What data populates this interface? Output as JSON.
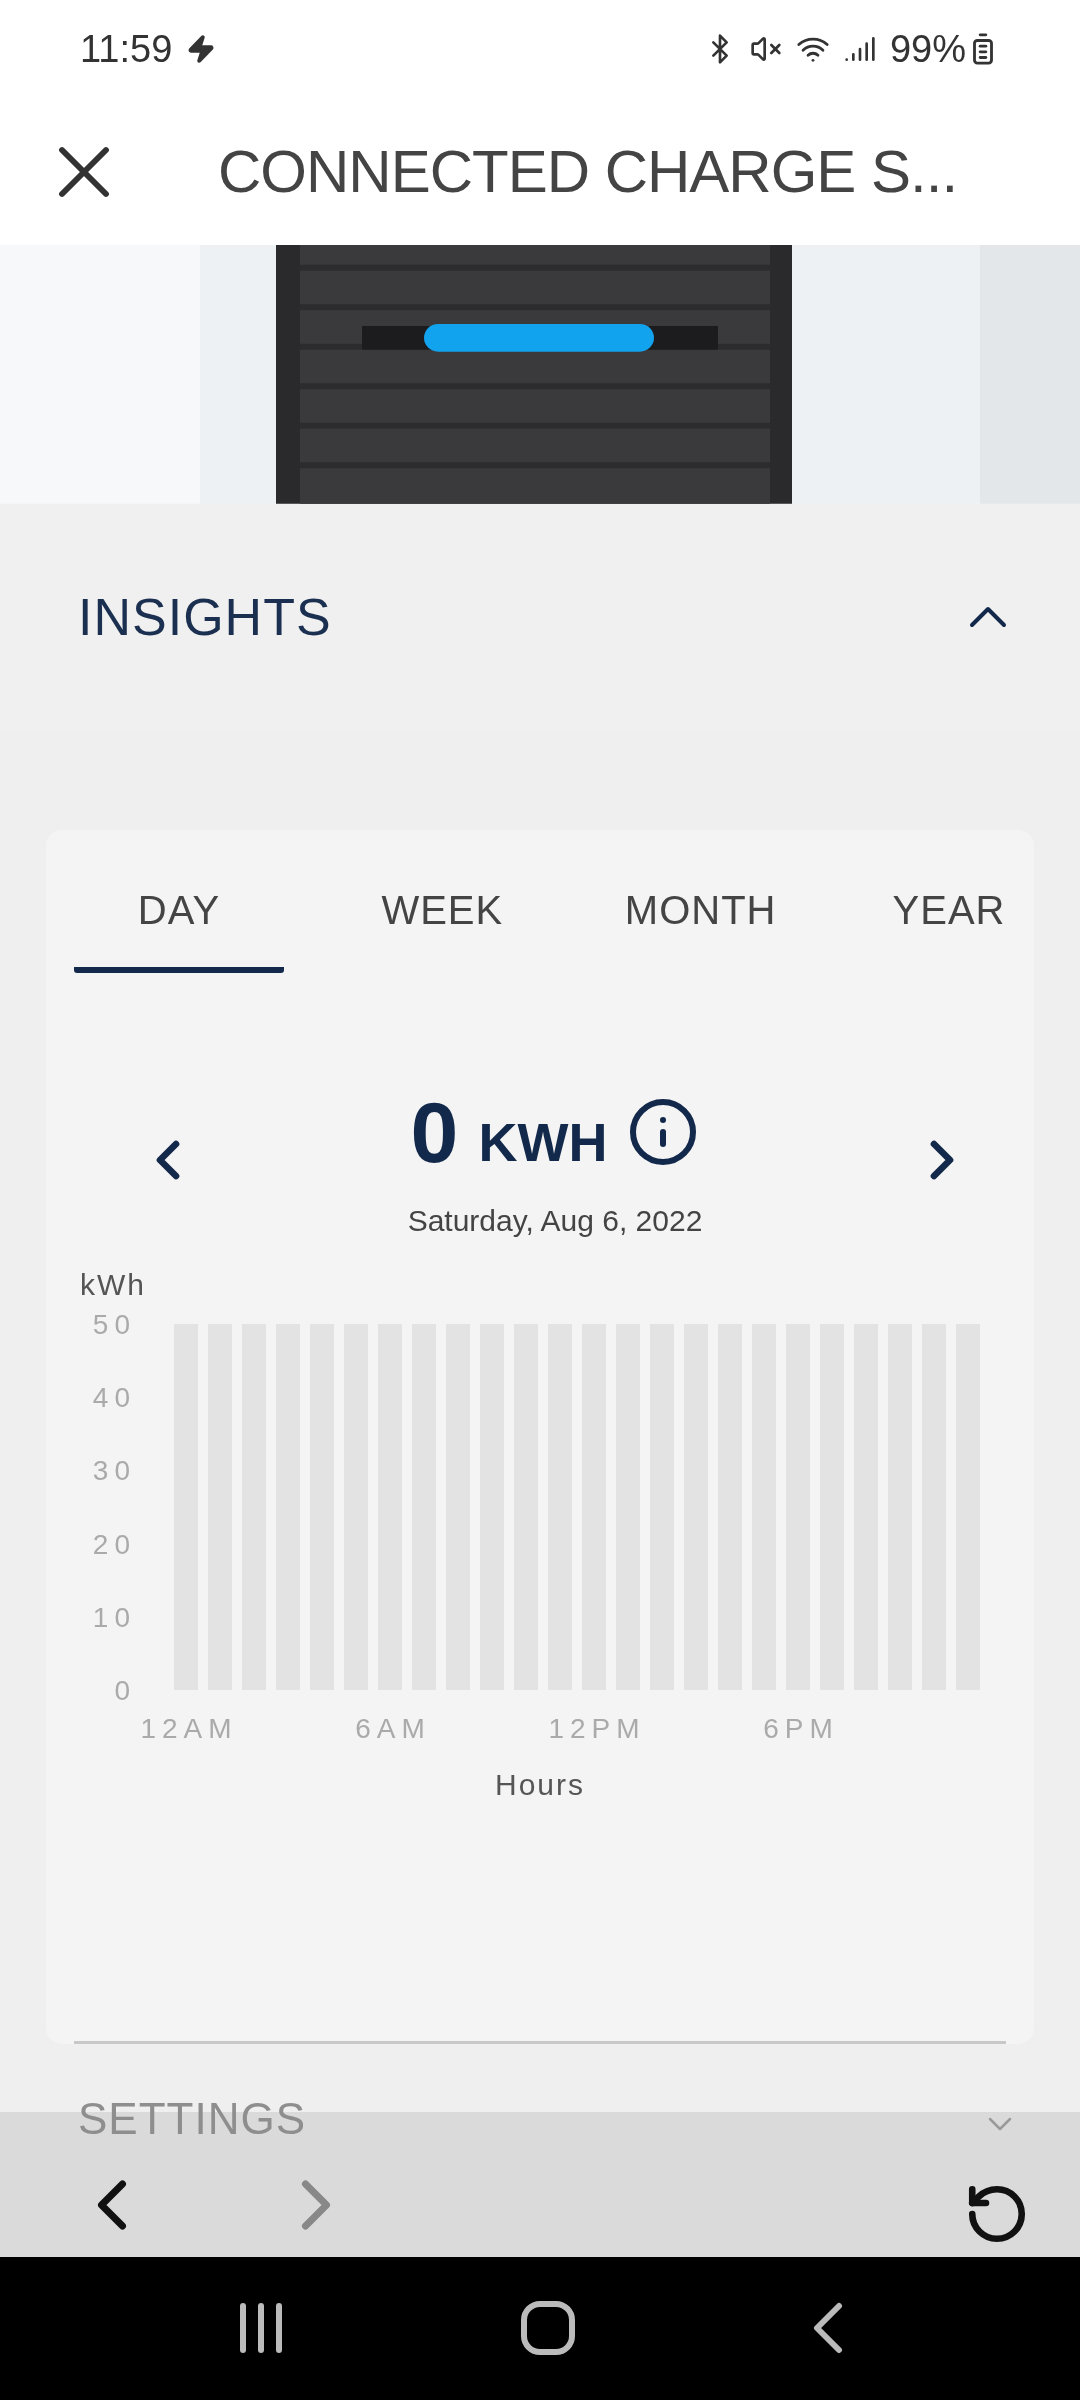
{
  "status_bar": {
    "time": "11:59",
    "battery": "99%"
  },
  "header": {
    "title": "CONNECTED CHARGE S..."
  },
  "insights": {
    "title": "INSIGHTS",
    "expanded": true,
    "tabs": [
      {
        "label": "DAY",
        "selected": true
      },
      {
        "label": "WEEK",
        "selected": false
      },
      {
        "label": "MONTH",
        "selected": false
      },
      {
        "label": "YEAR",
        "selected": false
      }
    ],
    "summary": {
      "value": "0",
      "unit": "KWH",
      "date": "Saturday, Aug 6, 2022"
    },
    "chart_data": {
      "type": "bar",
      "xlabel": "Hours",
      "ylabel": "kWh",
      "values": [
        0,
        0,
        0,
        0,
        0,
        0,
        0,
        0,
        0,
        0,
        0,
        0,
        0,
        0,
        0,
        0,
        0,
        0,
        0,
        0,
        0,
        0,
        0,
        0
      ],
      "categories": [
        "12AM",
        null,
        null,
        null,
        null,
        null,
        "6AM",
        null,
        null,
        null,
        null,
        null,
        "12PM",
        null,
        null,
        null,
        null,
        null,
        "6PM",
        null,
        null,
        null,
        null,
        null
      ],
      "ylim": [
        0,
        50
      ],
      "yticks": [
        0,
        10,
        20,
        30,
        40,
        50
      ]
    }
  },
  "settings": {
    "title": "SETTINGS",
    "expanded": false
  }
}
